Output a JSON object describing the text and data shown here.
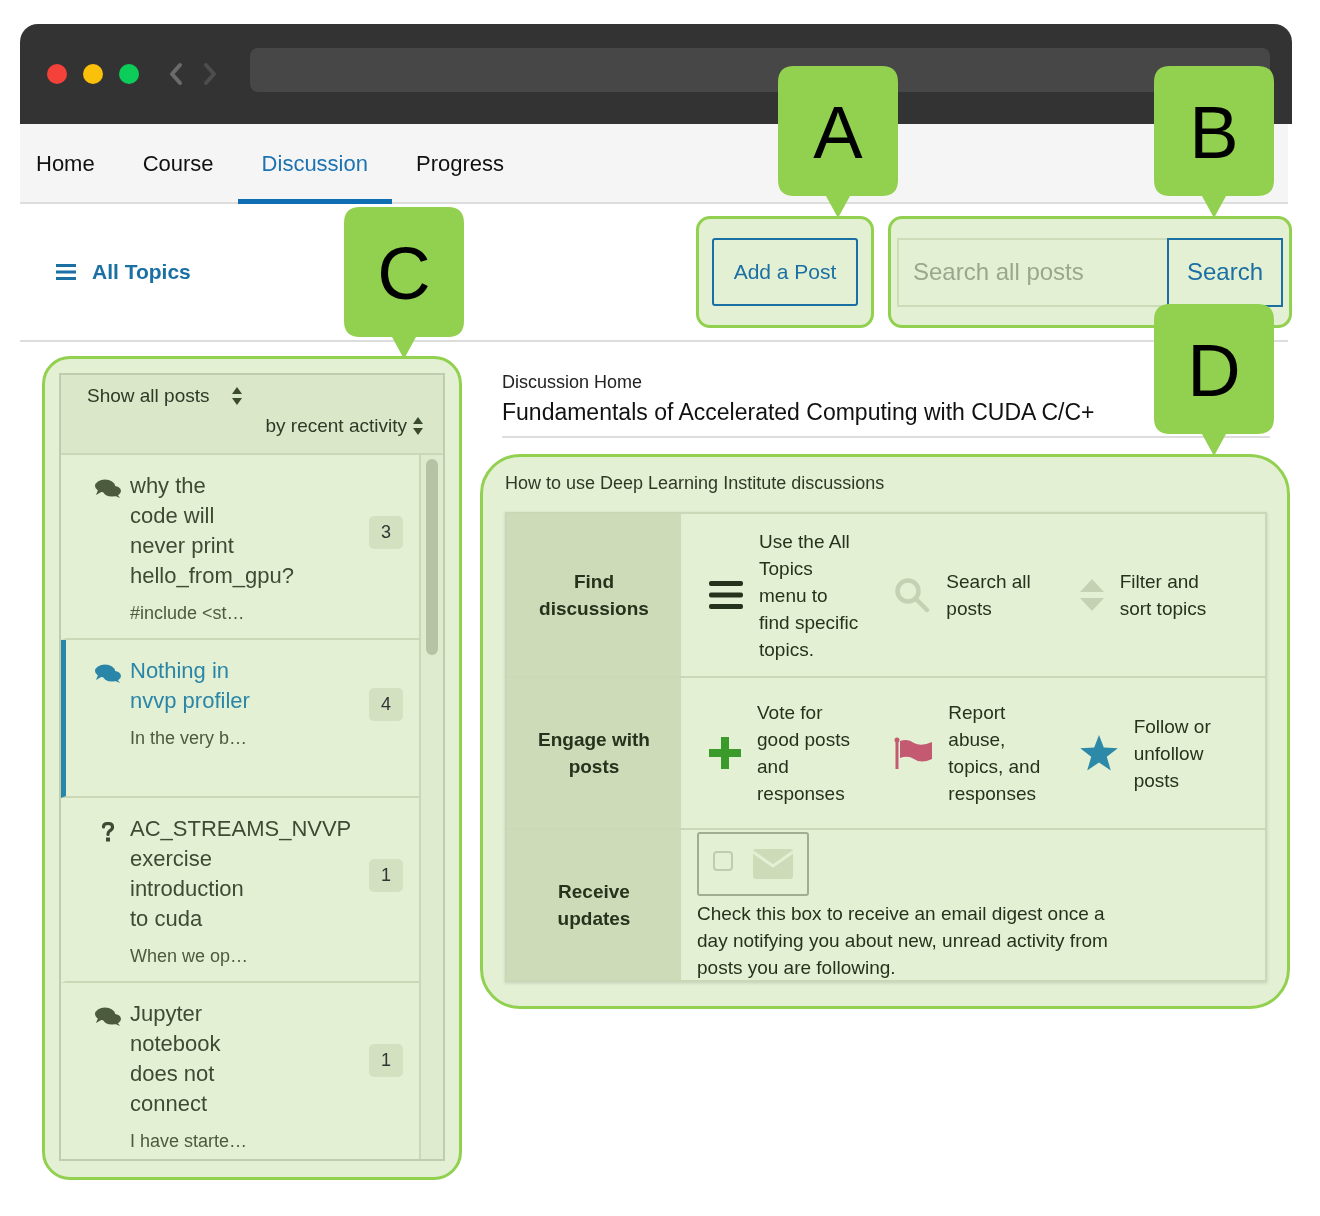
{
  "nav": {
    "tabs": [
      {
        "label": "Home",
        "selected": false
      },
      {
        "label": "Course",
        "selected": false
      },
      {
        "label": "Discussion",
        "selected": true
      },
      {
        "label": "Progress",
        "selected": false
      }
    ]
  },
  "toolbar": {
    "all_topics": "All Topics",
    "add_post": "Add a Post",
    "search": {
      "placeholder": "Search all posts",
      "button": "Search"
    }
  },
  "sidebar": {
    "filter": "Show all posts",
    "sort": "by recent activity",
    "threads": [
      {
        "kind": "discussion",
        "title": "why the code will never print hello_from_gpu?",
        "preview": "#include <st…",
        "count": "3",
        "selected": false
      },
      {
        "kind": "discussion",
        "title": "Nothing in nvvp profiler",
        "preview": "In the very b…",
        "count": "4",
        "selected": true
      },
      {
        "kind": "question",
        "title": "AC_STREAMS_NVVP exercise introduction to cuda",
        "preview": "When we op…",
        "count": "1",
        "selected": false
      },
      {
        "kind": "discussion",
        "title": "Jupyter notebook does not connect",
        "preview": "I have starte…",
        "count": "1",
        "selected": false
      }
    ]
  },
  "main": {
    "breadcrumb": "Discussion Home",
    "title": "Fundamentals of Accelerated Computing with CUDA C/C+",
    "guide": {
      "title": "How to use Deep Learning Institute discussions",
      "sections": [
        {
          "kind": "tips",
          "heading": "Find discussions",
          "items": [
            {
              "kind": "menu",
              "text": "Use the All Topics menu to find specific topics."
            },
            {
              "kind": "search",
              "text": "Search all posts"
            },
            {
              "kind": "sort",
              "text": "Filter and sort topics"
            }
          ]
        },
        {
          "kind": "tips",
          "heading": "Engage with posts",
          "items": [
            {
              "kind": "plus",
              "text": "Vote for good posts and responses"
            },
            {
              "kind": "flag",
              "text": "Report abuse, topics, and responses"
            },
            {
              "kind": "star",
              "text": "Follow or unfollow posts"
            }
          ]
        },
        {
          "kind": "subscribe",
          "heading": "Receive updates",
          "checked": false,
          "text": "Check this box to receive an email digest once a day notifying you about new, unread activity from posts you are following."
        }
      ]
    }
  },
  "callouts": [
    {
      "label": "A"
    },
    {
      "label": "B"
    },
    {
      "label": "C"
    },
    {
      "label": "D"
    }
  ]
}
